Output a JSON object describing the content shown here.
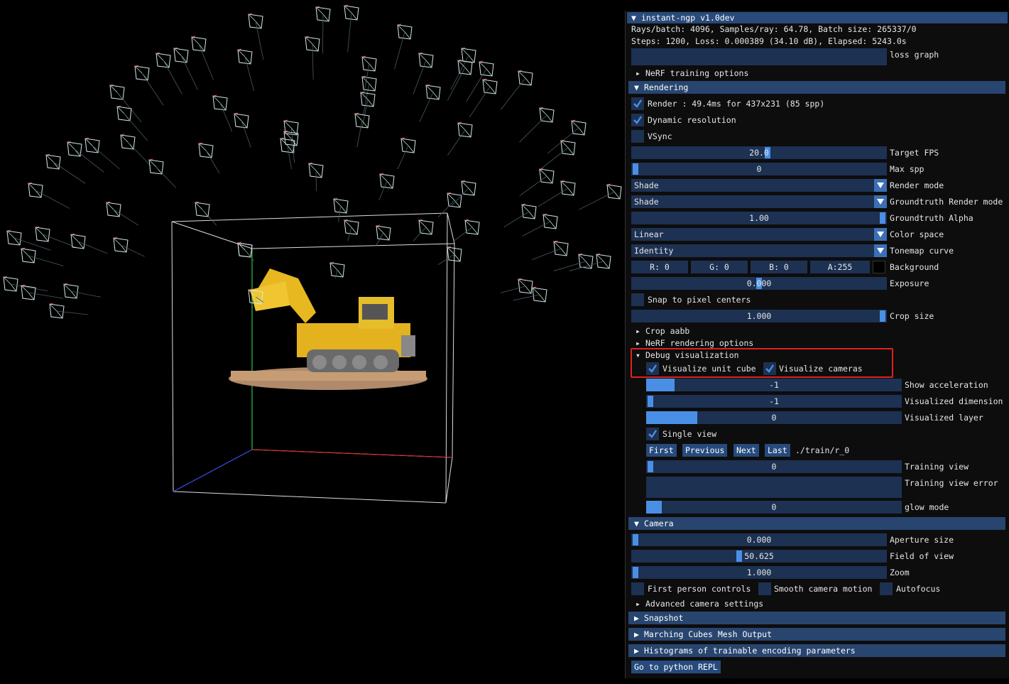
{
  "panel": {
    "title": "instant-ngp v1.0dev",
    "stats_line1": "Rays/batch: 4096, Samples/ray: 64.78, Batch size: 265337/0",
    "stats_line2": "Steps: 1200, Loss: 0.000389 (34.10 dB), Elapsed: 5243.0s",
    "loss_graph_label": "loss graph",
    "nerf_training_options": "NeRF training options",
    "rendering_header": "Rendering",
    "render_label": "Render : 49.4ms for 437x231 (85 spp)",
    "dynamic_resolution": "Dynamic resolution",
    "vsync": "VSync",
    "target_fps": {
      "value": "20.0",
      "label": "Target FPS"
    },
    "max_spp": {
      "value": "0",
      "label": "Max spp"
    },
    "render_mode": {
      "value": "Shade",
      "label": "Render mode"
    },
    "gt_render_mode": {
      "value": "Shade",
      "label": "Groundtruth Render mode"
    },
    "gt_alpha": {
      "value": "1.00",
      "label": "Groundtruth Alpha"
    },
    "color_space": {
      "value": "Linear",
      "label": "Color space"
    },
    "tonemap_curve": {
      "value": "Identity",
      "label": "Tonemap curve"
    },
    "background": {
      "r": "R:  0",
      "g": "G:  0",
      "b": "B:  0",
      "a": "A:255",
      "label": "Background",
      "color": "#000000"
    },
    "exposure": {
      "value": "0.000",
      "label": "Exposure"
    },
    "snap_pixel": "Snap to pixel centers",
    "crop_size": {
      "value": "1.000",
      "label": "Crop size"
    },
    "crop_aabb": "Crop aabb",
    "nerf_rendering_options": "NeRF rendering options",
    "debug_vis": "Debug visualization",
    "vis_unit_cube": "Visualize unit cube",
    "vis_cameras": "Visualize cameras",
    "show_accel": {
      "value": "-1",
      "label": "Show acceleration"
    },
    "vis_dimension": {
      "value": "-1",
      "label": "Visualized dimension"
    },
    "vis_layer": {
      "value": "0",
      "label": "Visualized layer"
    },
    "single_view": "Single view",
    "nav_first": "First",
    "nav_previous": "Previous",
    "nav_next": "Next",
    "nav_last": "Last",
    "train_path": "./train/r_0",
    "training_view": {
      "value": "0",
      "label": "Training view"
    },
    "training_view_error": "Training view error",
    "glow_mode": {
      "value": "0",
      "label": "glow mode"
    },
    "camera_header": "Camera",
    "aperture": {
      "value": "0.000",
      "label": "Aperture size"
    },
    "fov": {
      "value": "50.625",
      "label": "Field of view"
    },
    "zoom": {
      "value": "1.000",
      "label": "Zoom"
    },
    "first_person": "First person controls",
    "smooth_camera": "Smooth camera motion",
    "autofocus": "Autofocus",
    "advanced_camera": "Advanced camera settings",
    "snapshot_header": "Snapshot",
    "marching_header": "Marching Cubes Mesh Output",
    "histograms_header": "Histograms of trainable encoding parameters",
    "repl_button": "Go to python REPL"
  },
  "colors": {
    "accent": "#4a8fe6",
    "header": "#28456f",
    "frame": "#1d3152",
    "highlight_box": "#e02020"
  }
}
